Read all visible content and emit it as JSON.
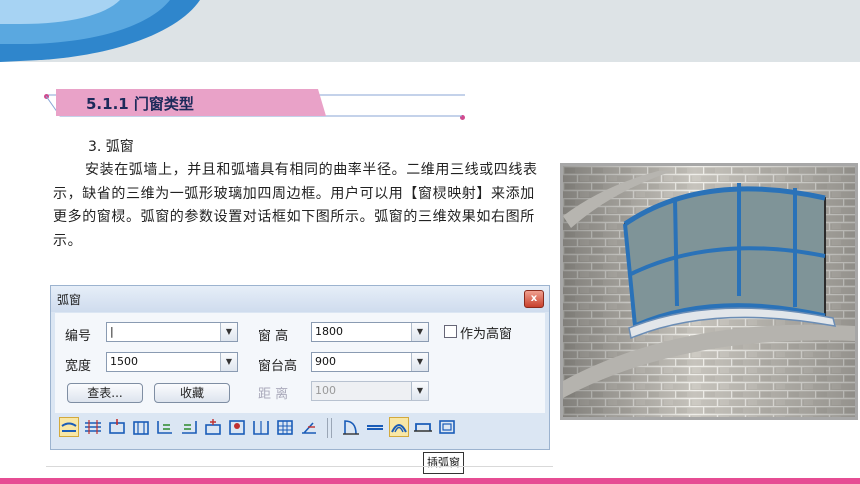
{
  "section": {
    "title": "5.1.1 门窗类型",
    "sub_heading": "3. 弧窗"
  },
  "body": {
    "paragraph": "安装在弧墙上，并且和弧墙具有相同的曲率半径。二维用三线或四线表示，缺省的三维为一弧形玻璃加四周边框。用户可以用【窗棂映射】来添加更多的窗棂。弧窗的参数设置对话框如下图所示。弧窗的三维效果如右图所示。"
  },
  "dialog": {
    "title": "弧窗",
    "close_label": "x",
    "fields": {
      "number": {
        "label": "编号",
        "value": "|"
      },
      "width": {
        "label": "宽度",
        "value": "1500"
      },
      "window_height": {
        "label": "窗 高",
        "value": "1800"
      },
      "sill_height": {
        "label": "窗台高",
        "value": "900"
      },
      "distance": {
        "label": "距 离",
        "value": "100"
      }
    },
    "high_window_label": "作为高窗",
    "lookup_button": "查表...",
    "favorite_button": "收藏",
    "tooltip": "插弧窗"
  },
  "colors": {
    "accent_pink": "#e64c93",
    "title_bar": "#e9a2c8",
    "dialog_bg": "#dbe6f3",
    "banner_blue": "#3a8fd0"
  },
  "icons": [
    "insert-free-icon",
    "insert-along-wall-icon",
    "insert-midpoint-icon",
    "insert-equal-icon",
    "insert-wall-left-icon",
    "insert-wall-right-icon",
    "insert-axis-icon",
    "insert-by-corner-icon",
    "insert-fill-icon",
    "insert-multi-icon",
    "insert-angle-icon",
    "door-type-icon",
    "window-type-icon",
    "arc-window-icon",
    "bay-window-icon",
    "opening-icon"
  ]
}
